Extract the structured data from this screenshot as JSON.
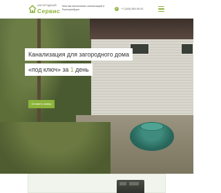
{
  "header": {
    "logo_small": "Загородный",
    "logo_big": "Сервис",
    "tagline": "Монтаж автономных канализаций в Екатеринбурге",
    "phone": "+7 (343) 383-09-51",
    "phone_icon": "phone-icon",
    "menu_icon": "hamburger-menu-icon"
  },
  "hero": {
    "title_line1": "Канализация для загородного дома",
    "title_line2_prefix": "«под ключ» за ",
    "title_line2_accent": "1",
    "title_line2_suffix": " день",
    "cta_label": "Оставить заявку"
  },
  "colors": {
    "accent": "#8cb33a",
    "text": "#333333",
    "muted": "#555555"
  }
}
